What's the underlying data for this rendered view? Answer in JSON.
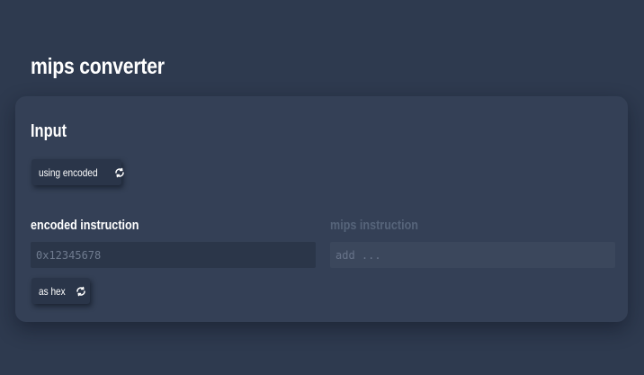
{
  "app": {
    "title": "mips converter"
  },
  "input_section": {
    "title": "Input",
    "mode_button_label": "using encoded",
    "encoded": {
      "label": "encoded instruction",
      "placeholder": "0x12345678",
      "value": ""
    },
    "mips": {
      "label": "mips instruction",
      "placeholder": "add ...",
      "value": "",
      "disabled": true
    },
    "format_button_label": "as hex"
  },
  "icons": {
    "mode_button_icon": "refresh-icon",
    "format_button_icon": "refresh-icon"
  },
  "colors": {
    "background": "#2e3a4f",
    "card": "#344056",
    "button": "#2a3549",
    "text": "#ffffff",
    "muted_label": "#56647a"
  }
}
